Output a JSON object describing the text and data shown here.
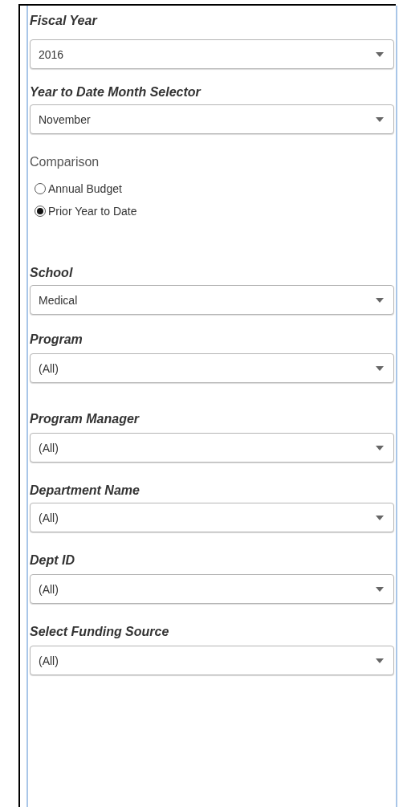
{
  "filters": [
    {
      "kind": "select",
      "label": "Fiscal Year",
      "value": "2016"
    },
    {
      "kind": "select",
      "label": "Year to Date Month Selector",
      "value": "November"
    },
    {
      "kind": "radio",
      "label": "Comparison",
      "options": [
        {
          "label": "Annual Budget",
          "selected": false
        },
        {
          "label": "Prior Year to Date",
          "selected": true
        }
      ]
    },
    {
      "kind": "select",
      "label": "School",
      "value": "Medical"
    },
    {
      "kind": "select",
      "label": "Program",
      "value": "(All)"
    },
    {
      "kind": "select",
      "label": "Program Manager",
      "value": "(All)"
    },
    {
      "kind": "select",
      "label": "Department Name",
      "value": "(All)"
    },
    {
      "kind": "select",
      "label": "Dept ID",
      "value": "(All)"
    },
    {
      "kind": "select",
      "label": "Select Funding Source",
      "value": "(All)"
    }
  ]
}
